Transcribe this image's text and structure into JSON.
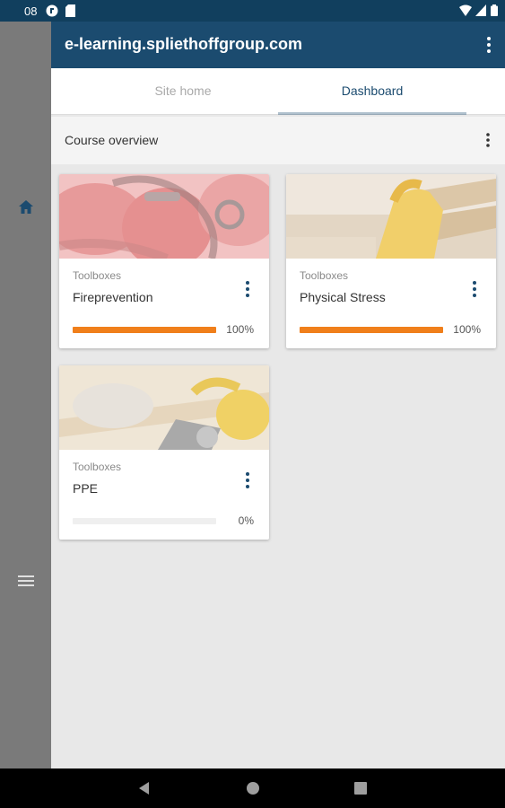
{
  "status_bar": {
    "time": "08",
    "icons": [
      "sync-icon",
      "sd-card-icon",
      "wifi-icon",
      "signal-icon",
      "battery-icon"
    ]
  },
  "side_rail": {
    "icons": [
      "home-icon",
      "hamburger-menu-icon"
    ],
    "active_color": "#1b4b6f"
  },
  "app_bar": {
    "title": "e-learning.spliethoffgroup.com",
    "icon": "overflow-menu-icon",
    "color": "#1b4b6f"
  },
  "tabs": [
    {
      "label": "Site home",
      "active": false
    },
    {
      "label": "Dashboard",
      "active": true
    }
  ],
  "course_overview": {
    "title": "Course overview",
    "icon": "overflow-menu-icon"
  },
  "courses": [
    {
      "category": "Toolboxes",
      "name": "Fireprevention",
      "progress": 100,
      "progress_label": "100%",
      "image": "fire-extinguisher-image"
    },
    {
      "category": "Toolboxes",
      "name": "Physical Stress",
      "progress": 100,
      "progress_label": "100%",
      "image": "work-glove-lumber-image"
    },
    {
      "category": "Toolboxes",
      "name": "PPE",
      "progress": 0,
      "progress_label": "0%",
      "image": "safety-gear-image"
    }
  ],
  "progress_color": "#f07f1b",
  "nav_bar": {
    "icons": [
      "back-icon",
      "home-circle-icon",
      "recents-icon"
    ]
  }
}
